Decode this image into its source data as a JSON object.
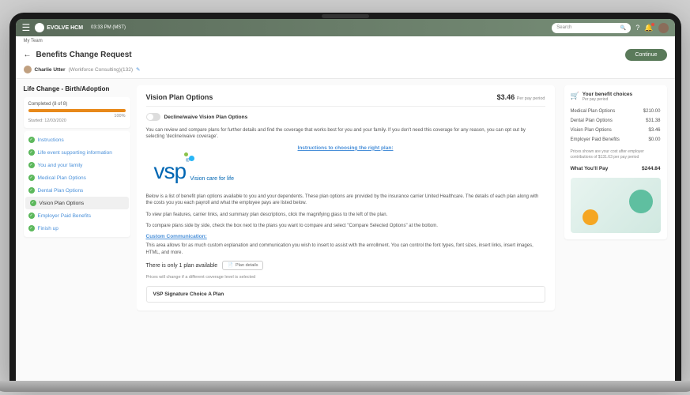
{
  "topbar": {
    "brand": "EVOLVE HCM",
    "time": "03:33 PM (MST)",
    "search_placeholder": "Search"
  },
  "breadcrumb": "My Team",
  "header": {
    "title": "Benefits Change Request",
    "continue": "Continue"
  },
  "user": {
    "name": "Charlie Utter",
    "org": "(Workforce Consulting)(132)"
  },
  "sidebar": {
    "title": "Life Change - Birth/Adoption",
    "progress_label": "Completed (8 of 8)",
    "progress_pct": "100%",
    "progress_date": "Started: 12/03/2020",
    "steps": [
      {
        "label": "Instructions"
      },
      {
        "label": "Life event supporting information"
      },
      {
        "label": "You and your family"
      },
      {
        "label": "Medical Plan Options"
      },
      {
        "label": "Dental Plan Options"
      },
      {
        "label": "Vision Plan Options"
      },
      {
        "label": "Employer Paid Benefits"
      },
      {
        "label": "Finish up"
      }
    ]
  },
  "main": {
    "card_title": "Vision Plan Options",
    "price": "$3.46",
    "price_sub": "Per pay period",
    "toggle_label": "Decline/waive Vision Plan Options",
    "intro": "You can review and compare plans for further details and find the coverage that works best for you and your family. If you don't need this coverage for any reason, you can opt out by selecting 'decline/waive coverage'.",
    "instructions_link": "Instructions to choosing the right plan:",
    "vsp_tagline": "Vision care for life",
    "body1": "Below is a list of benefit plan options available to you and your dependents.  These plan options are provided by the insurance carrier United Healthcare.  The details of each plan along with the costs you you each payroll and what the employee pays are listed below.",
    "body2": "To view plan features, carrier links, and summary plan descriptions, click the magnifying glass to the left of the plan.",
    "body3": "To compare plans side by side, check the box next to the plans you want to compare and select \"Compare Selected Options\" at the bottom.",
    "custom_link": "Custom Communication:",
    "body4": "This area allows for as much custom explanation and communication you wish to insert to assist with the enrollment. You can control the font types, font sizes, insert links, insert images, HTML, and more.",
    "avail_text": "There is only 1 plan available",
    "plan_details_btn": "Plan details",
    "price_note": "Prices will change if a different coverage level is selected",
    "plan_name": "VSP Signature Choice A Plan"
  },
  "right": {
    "choices_title": "Your benefit choices",
    "choices_sub": "Per pay period",
    "rows": [
      {
        "label": "Medical Plan Options",
        "value": "$210.00"
      },
      {
        "label": "Dental Plan Options",
        "value": "$31.38"
      },
      {
        "label": "Vision Plan Options",
        "value": "$3.46"
      },
      {
        "label": "Employer Paid Benefits",
        "value": "$0.00"
      }
    ],
    "note": "Prices shown are your cost after employer contributions of $131.63 per pay period",
    "pay_label": "What You'll Pay",
    "pay_value": "$244.84"
  }
}
